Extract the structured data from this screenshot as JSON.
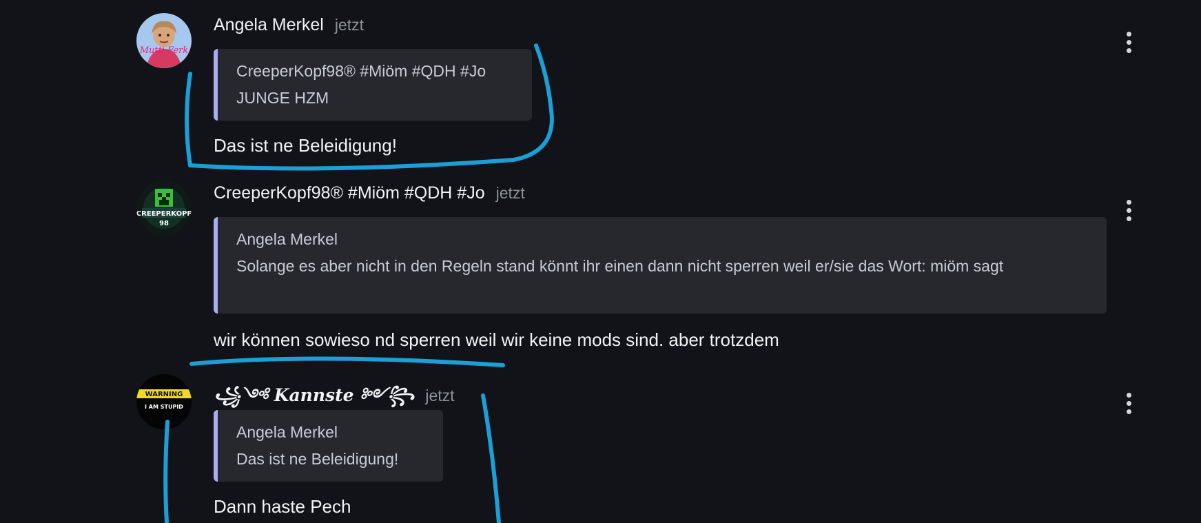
{
  "messages": [
    {
      "author": "Angela Merkel",
      "time": "jetzt",
      "avatar_icon": "cartoon-portrait-avatar",
      "avatar_caption": "Mutti Ferk",
      "quote": {
        "author": "CreeperKopf98® #Miöm #QDH #Jo",
        "text": "JUNGE HZM"
      },
      "text": "Das ist ne Beleidigung!"
    },
    {
      "author": "CreeperKopf98® #Miöm #QDH #Jo",
      "time": "jetzt",
      "avatar_icon": "creeper-logo-avatar",
      "avatar_caption_1": "CREEPERKOPF",
      "avatar_caption_2": "98",
      "quote": {
        "author": "Angela Merkel",
        "text": "Solange es aber nicht in den Regeln stand könnt ihr einen dann nicht sperren weil er/sie das Wort: miöm sagt"
      },
      "text": "wir können sowieso nd sperren weil wir keine mods sind. aber trotzdem"
    },
    {
      "author": "꧁༺ Kannste ༻꧂",
      "time": "jetzt",
      "avatar_icon": "warning-sign-avatar",
      "avatar_caption_1": "WARNING",
      "avatar_caption_2": "I AM STUPID",
      "quote": {
        "author": "Angela Merkel",
        "text": "Das ist ne Beleidigung!"
      },
      "text": "Dann haste Pech"
    }
  ],
  "icons": {
    "menu": "more-options-vertical-dots-icon"
  },
  "colors": {
    "background": "#111318",
    "quote_bg": "#26282d",
    "quote_bar": "#a9aef2",
    "annotation": "#1a9fd6",
    "timestamp": "#8e9297"
  }
}
